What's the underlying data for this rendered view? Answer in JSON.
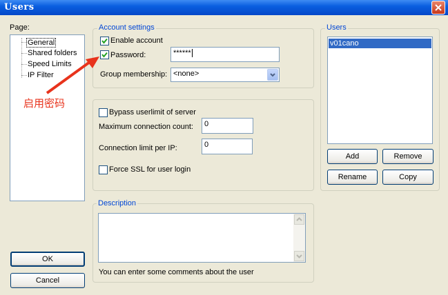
{
  "window": {
    "title": "Users"
  },
  "page_panel": {
    "label": "Page:",
    "items": [
      "General",
      "Shared folders",
      "Speed Limits",
      "IP Filter"
    ],
    "selected": "General"
  },
  "account": {
    "legend": "Account settings",
    "enable_label": "Enable account",
    "enable_checked": true,
    "password_label": "Password:",
    "password_checked": true,
    "password_value": "******",
    "group_label": "Group membership:",
    "group_value": "<none>"
  },
  "limits": {
    "bypass_label": "Bypass userlimit of server",
    "bypass_checked": false,
    "max_conn_label": "Maximum connection count:",
    "max_conn_value": "0",
    "conn_per_ip_label": "Connection limit per IP:",
    "conn_per_ip_value": "0",
    "ssl_label": "Force SSL for user login",
    "ssl_checked": false
  },
  "description": {
    "legend": "Description",
    "value": "",
    "hint": "You can enter some comments about the user"
  },
  "users": {
    "legend": "Users",
    "list": [
      "v01cano"
    ],
    "selected": "v01cano",
    "add_label": "Add",
    "remove_label": "Remove",
    "rename_label": "Rename",
    "copy_label": "Copy"
  },
  "buttons": {
    "ok_label": "OK",
    "cancel_label": "Cancel"
  },
  "annotation": {
    "text": "启用密码",
    "color": "#e8331c"
  },
  "colors": {
    "titlebar": "#0a5fe0",
    "selection": "#316ac5",
    "legend_text": "#0046d5",
    "dialog_bg": "#ece9d8"
  }
}
